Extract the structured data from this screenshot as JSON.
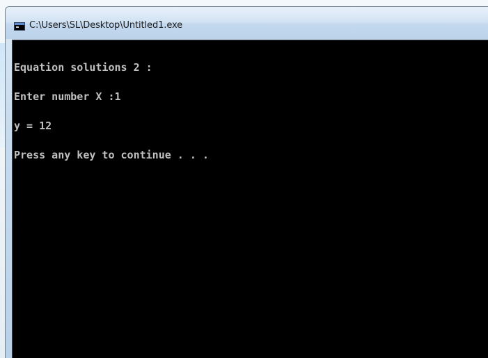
{
  "window": {
    "title": "C:\\Users\\SL\\Desktop\\Untitled1.exe",
    "icon": "console-app-icon"
  },
  "console": {
    "lines": [
      "Equation solutions 2 :",
      "Enter number X :1",
      "y = 12",
      "Press any key to continue . . ."
    ]
  },
  "colors": {
    "console_background": "#000000",
    "console_text": "#c0c0c0",
    "titlebar": "#c3d8ee"
  }
}
